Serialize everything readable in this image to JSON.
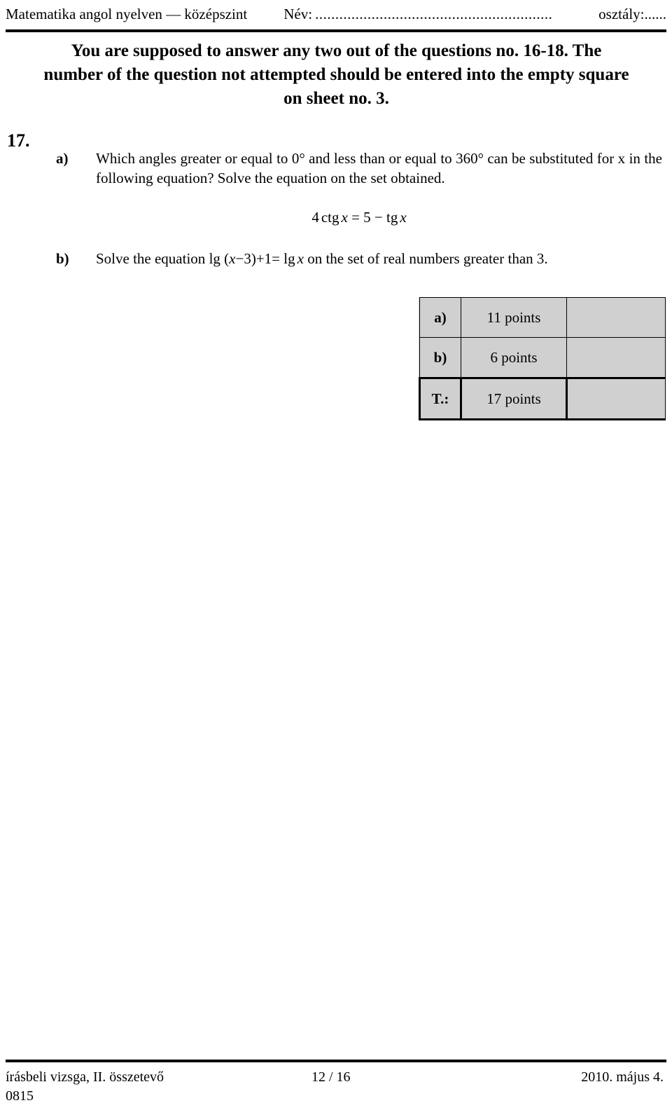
{
  "header": {
    "subject": "Matematika angol nyelven — középszint",
    "name_label": "Név:",
    "dots": "...........................................................",
    "class_label": "osztály:......"
  },
  "instruction": {
    "text": "You are supposed to answer any two out of the questions no. 16-18. The number of the question not attempted should be entered into the empty square on sheet no. 3."
  },
  "task": {
    "number": "17."
  },
  "questions": [
    {
      "label": "a)",
      "text": "Which angles greater or equal to 0° and less than or equal to 360° can be substituted for x in the following equation? Solve the equation on the set obtained.",
      "formula": {
        "coefficient": "4",
        "function1": "ctg",
        "variable1": "x",
        "equals": "=",
        "rhs_number": "5",
        "minus": "−",
        "function2": "tg",
        "variable2": "x",
        "plain": "4 ctg x = 5 − tg x"
      }
    },
    {
      "label": "b)",
      "text_before": "Solve the equation",
      "formula": {
        "lg1": "lg",
        "open_paren": "(",
        "variable1": "x",
        "minus": "−",
        "number3": "3",
        "close_paren": ")",
        "plus_one": "+1",
        "equals": "=",
        "lg2": "lg",
        "variable2": "x",
        "plain": "lg ( x − 3 ) + 1 = lg x"
      },
      "text_after": "on the set of real numbers greater than 3."
    }
  ],
  "points_table": {
    "rows": [
      {
        "label": "a)",
        "value": "11 points",
        "blank": ""
      },
      {
        "label": "b)",
        "value": "6 points",
        "blank": ""
      },
      {
        "label": "T.:",
        "value": "17 points",
        "blank": ""
      }
    ]
  },
  "footer": {
    "exam_type": "írásbeli vizsga, II. összetevő",
    "page": "12 / 16",
    "date": "2010. május 4.",
    "code": "0815"
  }
}
